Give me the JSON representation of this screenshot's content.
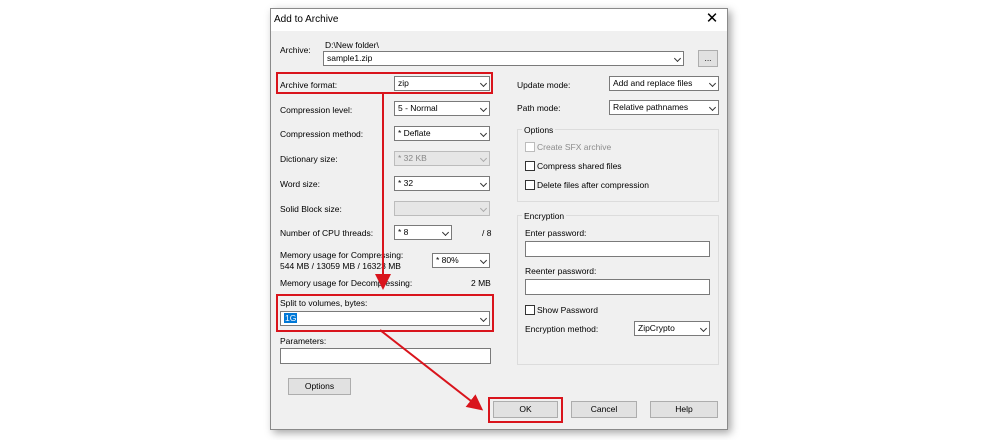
{
  "dialog": {
    "title": "Add to Archive",
    "close_glyph": "✕"
  },
  "archive": {
    "label": "Archive:",
    "path": "D:\\New folder\\",
    "filename": "sample1.zip",
    "browse_label": "..."
  },
  "left": {
    "archive_format": {
      "label": "Archive format:",
      "value": "zip"
    },
    "compression_level": {
      "label": "Compression level:",
      "value": "5 - Normal"
    },
    "compression_method": {
      "label": "Compression method:",
      "value": "* Deflate"
    },
    "dictionary_size": {
      "label": "Dictionary size:",
      "value": "* 32 KB"
    },
    "word_size": {
      "label": "Word size:",
      "value": "* 32"
    },
    "solid_block_size": {
      "label": "Solid Block size:",
      "value": ""
    },
    "cpu_threads": {
      "label": "Number of CPU threads:",
      "value": "* 8",
      "max": "/ 8"
    },
    "memory_compress": {
      "label": "Memory usage for Compressing:",
      "detail": "544 MB / 13059 MB / 16323 MB",
      "value": "* 80%"
    },
    "memory_decompress": {
      "label": "Memory usage for Decompressing:",
      "value": "2 MB"
    },
    "split_volumes": {
      "label": "Split to volumes, bytes:",
      "value": "1G"
    },
    "parameters": {
      "label": "Parameters:",
      "value": ""
    },
    "options_button": "Options"
  },
  "right": {
    "update_mode": {
      "label": "Update mode:",
      "value": "Add and replace files"
    },
    "path_mode": {
      "label": "Path mode:",
      "value": "Relative pathnames"
    },
    "options": {
      "title": "Options",
      "create_sfx": "Create SFX archive",
      "compress_shared": "Compress shared files",
      "delete_after": "Delete files after compression"
    },
    "encryption": {
      "title": "Encryption",
      "enter_password": "Enter password:",
      "reenter_password": "Reenter password:",
      "show_password": "Show Password",
      "method_label": "Encryption method:",
      "method_value": "ZipCrypto"
    }
  },
  "buttons": {
    "ok": "OK",
    "cancel": "Cancel",
    "help": "Help"
  },
  "colors": {
    "highlight": "#d9141c",
    "selection": "#0078d7"
  }
}
